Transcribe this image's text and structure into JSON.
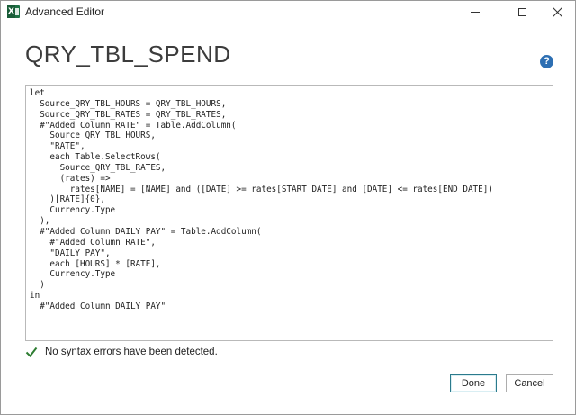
{
  "window": {
    "title": "Advanced Editor",
    "app_icon": "excel-icon",
    "controls": {
      "minimize_icon": "minimize-icon",
      "maximize_icon": "maximize-icon",
      "close_icon": "close-icon"
    }
  },
  "query": {
    "name": "QRY_TBL_SPEND",
    "help_icon": "help-icon",
    "help_glyph": "?"
  },
  "editor": {
    "lines": [
      "let",
      "  Source_QRY_TBL_HOURS = QRY_TBL_HOURS,",
      "  Source_QRY_TBL_RATES = QRY_TBL_RATES,",
      "  #\"Added Column RATE\" = Table.AddColumn(",
      "    Source_QRY_TBL_HOURS,",
      "    \"RATE\",",
      "    each Table.SelectRows(",
      "      Source_QRY_TBL_RATES,",
      "      (rates) =>",
      "        rates[NAME] = [NAME] and ([DATE] >= rates[START DATE] and [DATE] <= rates[END DATE])",
      "    )[RATE]{0},",
      "    Currency.Type",
      "  ),",
      "  #\"Added Column DAILY PAY\" = Table.AddColumn(",
      "    #\"Added Column RATE\",",
      "    \"DAILY PAY\",",
      "    each [HOURS] * [RATE],",
      "    Currency.Type",
      "  )",
      "in",
      "  #\"Added Column DAILY PAY\""
    ]
  },
  "status": {
    "icon": "checkmark-icon",
    "text": "No syntax errors have been detected.",
    "color": "#2e7d32"
  },
  "buttons": {
    "done_label": "Done",
    "cancel_label": "Cancel"
  },
  "colors": {
    "accent": "#2d6fb3",
    "excel_green": "#1e7145"
  }
}
